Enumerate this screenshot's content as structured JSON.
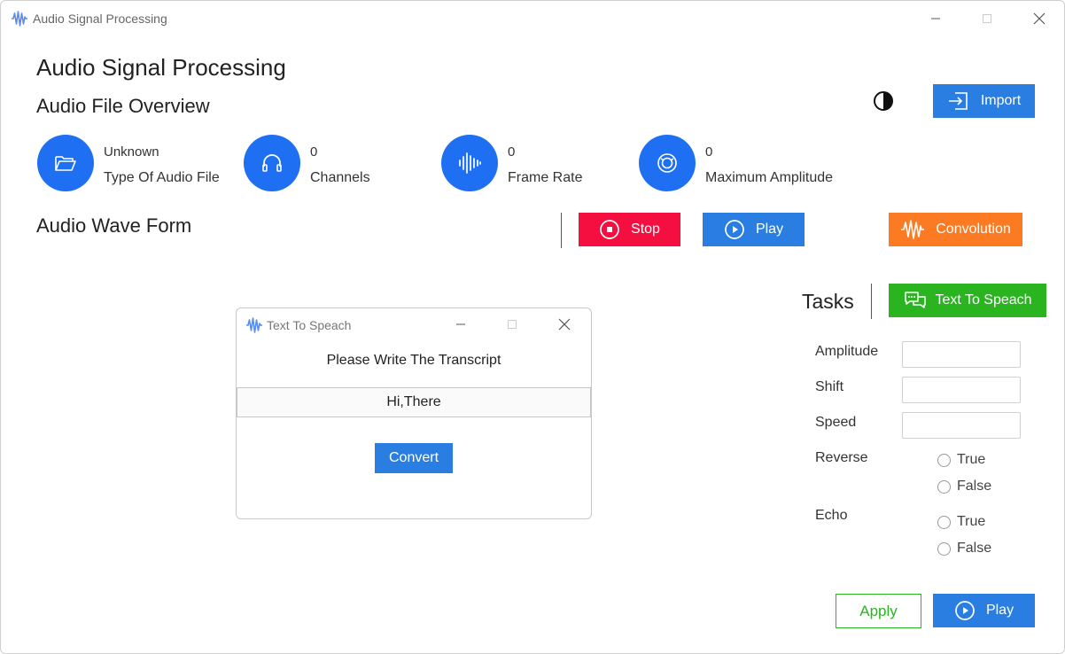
{
  "window": {
    "title": "Audio Signal Processing"
  },
  "header": {
    "app_title": "Audio Signal Processing",
    "overview_title": "Audio File Overview",
    "import_label": "Import"
  },
  "stats": [
    {
      "value": "Unknown",
      "label": "Type Of Audio File",
      "icon": "folder-icon"
    },
    {
      "value": "0",
      "label": "Channels",
      "icon": "headphones-icon"
    },
    {
      "value": "0",
      "label": "Frame Rate",
      "icon": "soundwave-icon"
    },
    {
      "value": "0",
      "label": "Maximum Amplitude",
      "icon": "amplitude-icon"
    }
  ],
  "waveform": {
    "title": "Audio Wave Form",
    "stop_label": "Stop",
    "play_label": "Play",
    "convolution_label": "Convolution"
  },
  "tasks": {
    "title": "Tasks",
    "tts_label": "Text To Speach",
    "amplitude_label": "Amplitude",
    "shift_label": "Shift",
    "speed_label": "Speed",
    "reverse_label": "Reverse",
    "echo_label": "Echo",
    "true_label": "True",
    "false_label": "False",
    "apply_label": "Apply",
    "play_label": "Play"
  },
  "dialog": {
    "title": "Text To Speach",
    "prompt": "Please Write The Transcript",
    "input_value": "Hi,There",
    "convert_label": "Convert"
  },
  "colors": {
    "accent_blue": "#2a7de1",
    "stat_blue": "#1f6ff2",
    "stop_red": "#f50f41",
    "convolution_orange": "#fb7a22",
    "tts_green": "#2ab520",
    "divider_purple": "#9b1fb8"
  }
}
